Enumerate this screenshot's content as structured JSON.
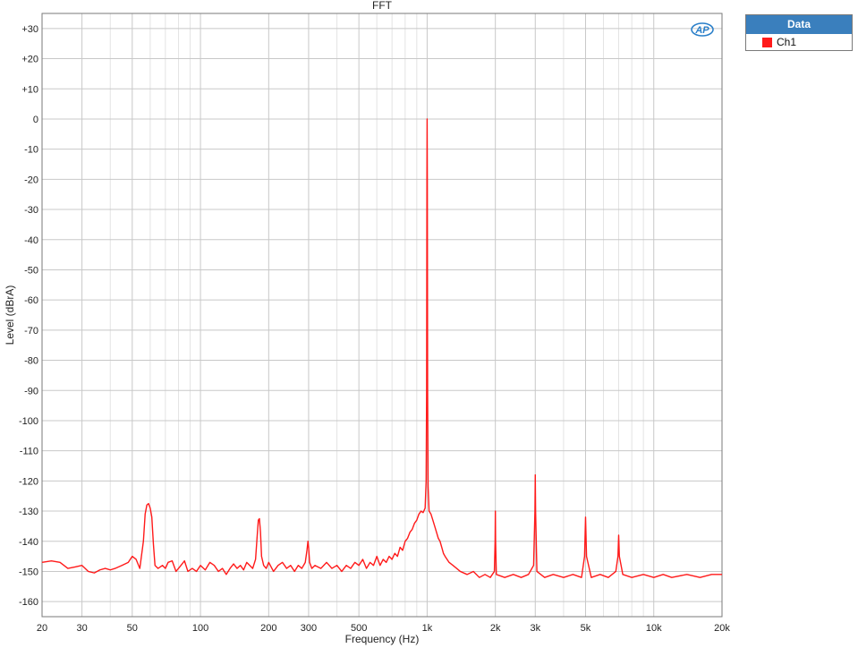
{
  "chart_data": {
    "type": "line",
    "title": "FFT",
    "xlabel": "Frequency (Hz)",
    "ylabel": "Level (dBrA)",
    "xscale": "log",
    "xlim": [
      20,
      20000
    ],
    "ylim": [
      -165,
      35
    ],
    "grid": true,
    "legend_placement": "top-right (outside plot)",
    "legend_title": "Data",
    "x_ticks": [
      20,
      30,
      50,
      100,
      200,
      300,
      500,
      1000,
      2000,
      3000,
      5000,
      10000,
      20000
    ],
    "x_tick_labels": [
      "20",
      "30",
      "50",
      "100",
      "200",
      "300",
      "500",
      "1k",
      "2k",
      "3k",
      "5k",
      "10k",
      "20k"
    ],
    "y_ticks": [
      30,
      20,
      10,
      0,
      -10,
      -20,
      -30,
      -40,
      -50,
      -60,
      -70,
      -80,
      -90,
      -100,
      -110,
      -120,
      -130,
      -140,
      -150,
      -160
    ],
    "y_tick_labels": [
      "+30",
      "+20",
      "+10",
      "0",
      "-10",
      "-20",
      "-30",
      "-40",
      "-50",
      "-60",
      "-70",
      "-80",
      "-90",
      "-100",
      "-110",
      "-120",
      "-130",
      "-140",
      "-150",
      "-160"
    ],
    "series": [
      {
        "name": "Ch1",
        "color": "#ff1a1a",
        "points": [
          [
            20,
            -147
          ],
          [
            22,
            -146.5
          ],
          [
            24,
            -147
          ],
          [
            26,
            -149
          ],
          [
            28,
            -148.5
          ],
          [
            30,
            -148
          ],
          [
            32,
            -150
          ],
          [
            34,
            -150.5
          ],
          [
            36,
            -149.5
          ],
          [
            38,
            -149
          ],
          [
            40,
            -149.5
          ],
          [
            42,
            -149
          ],
          [
            45,
            -148
          ],
          [
            48,
            -147
          ],
          [
            50,
            -145
          ],
          [
            52,
            -146
          ],
          [
            54,
            -149
          ],
          [
            56,
            -140
          ],
          [
            57,
            -131
          ],
          [
            58,
            -128
          ],
          [
            59,
            -127.5
          ],
          [
            60,
            -129
          ],
          [
            61,
            -132
          ],
          [
            62,
            -141
          ],
          [
            63,
            -148
          ],
          [
            65,
            -149
          ],
          [
            68,
            -148
          ],
          [
            70,
            -149
          ],
          [
            72,
            -147
          ],
          [
            75,
            -146.5
          ],
          [
            78,
            -150
          ],
          [
            82,
            -148
          ],
          [
            85,
            -146.5
          ],
          [
            88,
            -150
          ],
          [
            92,
            -149
          ],
          [
            96,
            -150
          ],
          [
            100,
            -148
          ],
          [
            105,
            -149.5
          ],
          [
            110,
            -147
          ],
          [
            115,
            -148
          ],
          [
            120,
            -150
          ],
          [
            125,
            -149
          ],
          [
            130,
            -151
          ],
          [
            135,
            -149
          ],
          [
            140,
            -147.5
          ],
          [
            145,
            -149
          ],
          [
            150,
            -148
          ],
          [
            155,
            -149.5
          ],
          [
            160,
            -147
          ],
          [
            165,
            -148
          ],
          [
            170,
            -149
          ],
          [
            175,
            -146
          ],
          [
            178,
            -138
          ],
          [
            180,
            -133
          ],
          [
            182,
            -132.5
          ],
          [
            184,
            -137
          ],
          [
            186,
            -145
          ],
          [
            190,
            -148
          ],
          [
            195,
            -149
          ],
          [
            200,
            -147
          ],
          [
            210,
            -150
          ],
          [
            220,
            -148
          ],
          [
            230,
            -147
          ],
          [
            240,
            -149
          ],
          [
            250,
            -148
          ],
          [
            260,
            -150
          ],
          [
            270,
            -148
          ],
          [
            280,
            -149
          ],
          [
            290,
            -147
          ],
          [
            295,
            -143
          ],
          [
            298,
            -140
          ],
          [
            300,
            -142
          ],
          [
            303,
            -147
          ],
          [
            310,
            -149
          ],
          [
            320,
            -148
          ],
          [
            340,
            -149
          ],
          [
            360,
            -147
          ],
          [
            380,
            -149
          ],
          [
            400,
            -148
          ],
          [
            420,
            -150
          ],
          [
            440,
            -148
          ],
          [
            460,
            -149
          ],
          [
            480,
            -147
          ],
          [
            500,
            -148
          ],
          [
            520,
            -146
          ],
          [
            540,
            -149
          ],
          [
            560,
            -147
          ],
          [
            580,
            -148
          ],
          [
            600,
            -145
          ],
          [
            620,
            -148
          ],
          [
            640,
            -146
          ],
          [
            660,
            -147
          ],
          [
            680,
            -145
          ],
          [
            700,
            -146
          ],
          [
            720,
            -144
          ],
          [
            740,
            -145
          ],
          [
            760,
            -142
          ],
          [
            780,
            -143
          ],
          [
            800,
            -140
          ],
          [
            820,
            -139
          ],
          [
            840,
            -137
          ],
          [
            860,
            -136
          ],
          [
            880,
            -134
          ],
          [
            900,
            -133
          ],
          [
            920,
            -131
          ],
          [
            940,
            -130
          ],
          [
            960,
            -130.5
          ],
          [
            980,
            -129
          ],
          [
            990,
            -120
          ],
          [
            995,
            -90
          ],
          [
            998,
            -20
          ],
          [
            1000,
            0
          ],
          [
            1002,
            -20
          ],
          [
            1005,
            -90
          ],
          [
            1010,
            -122
          ],
          [
            1020,
            -130
          ],
          [
            1040,
            -131
          ],
          [
            1060,
            -133
          ],
          [
            1080,
            -135
          ],
          [
            1100,
            -137
          ],
          [
            1120,
            -139
          ],
          [
            1140,
            -140
          ],
          [
            1160,
            -142
          ],
          [
            1180,
            -144
          ],
          [
            1200,
            -145
          ],
          [
            1250,
            -147
          ],
          [
            1300,
            -148
          ],
          [
            1350,
            -149
          ],
          [
            1400,
            -150
          ],
          [
            1500,
            -151
          ],
          [
            1600,
            -150
          ],
          [
            1700,
            -152
          ],
          [
            1800,
            -151
          ],
          [
            1900,
            -152
          ],
          [
            1980,
            -150
          ],
          [
            1995,
            -140
          ],
          [
            2000,
            -130
          ],
          [
            2005,
            -140
          ],
          [
            2020,
            -151
          ],
          [
            2200,
            -152
          ],
          [
            2400,
            -151
          ],
          [
            2600,
            -152
          ],
          [
            2800,
            -151
          ],
          [
            2950,
            -148
          ],
          [
            2990,
            -130
          ],
          [
            3000,
            -118
          ],
          [
            3010,
            -130
          ],
          [
            3050,
            -150
          ],
          [
            3300,
            -152
          ],
          [
            3600,
            -151
          ],
          [
            4000,
            -152
          ],
          [
            4400,
            -151
          ],
          [
            4800,
            -152
          ],
          [
            4950,
            -145
          ],
          [
            5000,
            -132
          ],
          [
            5050,
            -145
          ],
          [
            5300,
            -152
          ],
          [
            5800,
            -151
          ],
          [
            6300,
            -152
          ],
          [
            6800,
            -150
          ],
          [
            6950,
            -145
          ],
          [
            7000,
            -138
          ],
          [
            7050,
            -145
          ],
          [
            7300,
            -151
          ],
          [
            8000,
            -152
          ],
          [
            9000,
            -151
          ],
          [
            10000,
            -152
          ],
          [
            11000,
            -151
          ],
          [
            12000,
            -152
          ],
          [
            14000,
            -151
          ],
          [
            16000,
            -152
          ],
          [
            18000,
            -151
          ],
          [
            20000,
            -151
          ]
        ]
      }
    ]
  }
}
